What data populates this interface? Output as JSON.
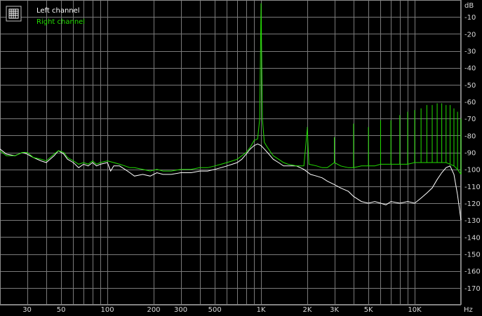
{
  "chart_data": {
    "type": "line",
    "xlabel": "Hz",
    "ylabel": "dB",
    "x_scale": "log",
    "xlim": [
      20,
      20000
    ],
    "ylim": [
      -180,
      0
    ],
    "grid": true,
    "legend_placement": "top-left",
    "x_ticks": [
      {
        "value": 30,
        "label": "30"
      },
      {
        "value": 50,
        "label": "50"
      },
      {
        "value": 100,
        "label": "100"
      },
      {
        "value": 200,
        "label": "200"
      },
      {
        "value": 300,
        "label": "300"
      },
      {
        "value": 500,
        "label": "500"
      },
      {
        "value": 1000,
        "label": "1K"
      },
      {
        "value": 2000,
        "label": "2K"
      },
      {
        "value": 3000,
        "label": "3K"
      },
      {
        "value": 5000,
        "label": "5K"
      },
      {
        "value": 10000,
        "label": "10K"
      }
    ],
    "y_ticks": [
      {
        "value": -10,
        "label": "-10"
      },
      {
        "value": -20,
        "label": "-20"
      },
      {
        "value": -30,
        "label": "-30"
      },
      {
        "value": -40,
        "label": "-40"
      },
      {
        "value": -50,
        "label": "-50"
      },
      {
        "value": -60,
        "label": "-60"
      },
      {
        "value": -70,
        "label": "-70"
      },
      {
        "value": -80,
        "label": "-80"
      },
      {
        "value": -90,
        "label": "-90"
      },
      {
        "value": -100,
        "label": "-100"
      },
      {
        "value": -110,
        "label": "-110"
      },
      {
        "value": -120,
        "label": "-120"
      },
      {
        "value": -130,
        "label": "-130"
      },
      {
        "value": -140,
        "label": "-140"
      },
      {
        "value": -150,
        "label": "-150"
      },
      {
        "value": -160,
        "label": "-160"
      },
      {
        "value": -170,
        "label": "-170"
      }
    ],
    "series": [
      {
        "name": "Left channel",
        "color": "#ffffff",
        "points": [
          [
            20,
            -88
          ],
          [
            22,
            -91
          ],
          [
            25,
            -92
          ],
          [
            28,
            -90
          ],
          [
            30,
            -91
          ],
          [
            33,
            -93
          ],
          [
            37,
            -95
          ],
          [
            40,
            -96
          ],
          [
            45,
            -92
          ],
          [
            48,
            -89
          ],
          [
            52,
            -91
          ],
          [
            55,
            -94
          ],
          [
            60,
            -96
          ],
          [
            65,
            -99
          ],
          [
            70,
            -97
          ],
          [
            75,
            -98
          ],
          [
            80,
            -96
          ],
          [
            85,
            -98
          ],
          [
            90,
            -97
          ],
          [
            100,
            -96
          ],
          [
            105,
            -101
          ],
          [
            110,
            -98
          ],
          [
            120,
            -98
          ],
          [
            130,
            -100
          ],
          [
            140,
            -102
          ],
          [
            150,
            -104
          ],
          [
            170,
            -103
          ],
          [
            190,
            -104
          ],
          [
            210,
            -102
          ],
          [
            230,
            -103
          ],
          [
            260,
            -103
          ],
          [
            300,
            -102
          ],
          [
            350,
            -102
          ],
          [
            400,
            -101
          ],
          [
            450,
            -101
          ],
          [
            500,
            -100
          ],
          [
            550,
            -99
          ],
          [
            600,
            -98
          ],
          [
            650,
            -97
          ],
          [
            700,
            -96
          ],
          [
            750,
            -94
          ],
          [
            800,
            -91
          ],
          [
            850,
            -88
          ],
          [
            900,
            -86
          ],
          [
            950,
            -85
          ],
          [
            1000,
            -86
          ],
          [
            1050,
            -88
          ],
          [
            1100,
            -90
          ],
          [
            1200,
            -94
          ],
          [
            1300,
            -96
          ],
          [
            1400,
            -98
          ],
          [
            1500,
            -98
          ],
          [
            1700,
            -98
          ],
          [
            1900,
            -100
          ],
          [
            2100,
            -103
          ],
          [
            2300,
            -104
          ],
          [
            2500,
            -105
          ],
          [
            2700,
            -107
          ],
          [
            3000,
            -109
          ],
          [
            3300,
            -111
          ],
          [
            3700,
            -113
          ],
          [
            4000,
            -116
          ],
          [
            4500,
            -119
          ],
          [
            5000,
            -120
          ],
          [
            5500,
            -119
          ],
          [
            6000,
            -120
          ],
          [
            6500,
            -121
          ],
          [
            7000,
            -119
          ],
          [
            8000,
            -120
          ],
          [
            9000,
            -119
          ],
          [
            10000,
            -120
          ],
          [
            11000,
            -117
          ],
          [
            12000,
            -114
          ],
          [
            13000,
            -111
          ],
          [
            14000,
            -106
          ],
          [
            15000,
            -102
          ],
          [
            16000,
            -99
          ],
          [
            17000,
            -98
          ],
          [
            18000,
            -103
          ],
          [
            19000,
            -115
          ],
          [
            20000,
            -130
          ]
        ]
      },
      {
        "name": "Right channel",
        "color": "#22dd00",
        "points": [
          [
            20,
            -89
          ],
          [
            22,
            -92
          ],
          [
            25,
            -92
          ],
          [
            28,
            -90
          ],
          [
            30,
            -90
          ],
          [
            33,
            -93
          ],
          [
            37,
            -94
          ],
          [
            40,
            -95
          ],
          [
            45,
            -91
          ],
          [
            48,
            -89
          ],
          [
            52,
            -90
          ],
          [
            55,
            -93
          ],
          [
            60,
            -95
          ],
          [
            65,
            -97
          ],
          [
            70,
            -96
          ],
          [
            75,
            -97
          ],
          [
            80,
            -95
          ],
          [
            85,
            -97
          ],
          [
            90,
            -96
          ],
          [
            100,
            -95
          ],
          [
            110,
            -96
          ],
          [
            120,
            -97
          ],
          [
            130,
            -98
          ],
          [
            140,
            -99
          ],
          [
            150,
            -99
          ],
          [
            170,
            -100
          ],
          [
            190,
            -101
          ],
          [
            210,
            -100
          ],
          [
            230,
            -101
          ],
          [
            260,
            -101
          ],
          [
            300,
            -100
          ],
          [
            350,
            -100
          ],
          [
            400,
            -99
          ],
          [
            450,
            -99
          ],
          [
            500,
            -98
          ],
          [
            550,
            -97
          ],
          [
            600,
            -96
          ],
          [
            650,
            -95
          ],
          [
            700,
            -94
          ],
          [
            750,
            -92
          ],
          [
            800,
            -90
          ],
          [
            850,
            -87
          ],
          [
            900,
            -83
          ],
          [
            950,
            -82
          ],
          [
            980,
            -70
          ],
          [
            1000,
            -2
          ],
          [
            1020,
            -70
          ],
          [
            1050,
            -84
          ],
          [
            1100,
            -87
          ],
          [
            1200,
            -92
          ],
          [
            1300,
            -94
          ],
          [
            1400,
            -96
          ],
          [
            1500,
            -97
          ],
          [
            1700,
            -98
          ],
          [
            1900,
            -98
          ],
          [
            2000,
            -76
          ],
          [
            2050,
            -97
          ],
          [
            2300,
            -98
          ],
          [
            2500,
            -99
          ],
          [
            2700,
            -99
          ],
          [
            3000,
            -96
          ],
          [
            3300,
            -98
          ],
          [
            3700,
            -99
          ],
          [
            4000,
            -99
          ],
          [
            4500,
            -98
          ],
          [
            5000,
            -98
          ],
          [
            5500,
            -98
          ],
          [
            6000,
            -97
          ],
          [
            6500,
            -97
          ],
          [
            7000,
            -97
          ],
          [
            8000,
            -97
          ],
          [
            9000,
            -97
          ],
          [
            10000,
            -96
          ],
          [
            11000,
            -96
          ],
          [
            12000,
            -96
          ],
          [
            13000,
            -96
          ],
          [
            14000,
            -96
          ],
          [
            15000,
            -96
          ],
          [
            16000,
            -96
          ],
          [
            17000,
            -97
          ],
          [
            18000,
            -98
          ],
          [
            19000,
            -100
          ],
          [
            20000,
            -103
          ]
        ]
      }
    ],
    "harmonic_spikes": [
      {
        "series": "Right channel",
        "x": 2000,
        "y": -75
      },
      {
        "series": "Right channel",
        "x": 3000,
        "y": -81
      },
      {
        "series": "Right channel",
        "x": 4000,
        "y": -73
      },
      {
        "series": "Right channel",
        "x": 5000,
        "y": -75
      },
      {
        "series": "Right channel",
        "x": 6000,
        "y": -71
      },
      {
        "series": "Right channel",
        "x": 7000,
        "y": -71
      },
      {
        "series": "Right channel",
        "x": 8000,
        "y": -68
      },
      {
        "series": "Right channel",
        "x": 9000,
        "y": -66
      },
      {
        "series": "Right channel",
        "x": 10000,
        "y": -65
      },
      {
        "series": "Right channel",
        "x": 11000,
        "y": -64
      },
      {
        "series": "Right channel",
        "x": 12000,
        "y": -62
      },
      {
        "series": "Right channel",
        "x": 13000,
        "y": -62
      },
      {
        "series": "Right channel",
        "x": 14000,
        "y": -61
      },
      {
        "series": "Right channel",
        "x": 15000,
        "y": -61
      },
      {
        "series": "Right channel",
        "x": 16000,
        "y": -62
      },
      {
        "series": "Right channel",
        "x": 17000,
        "y": -62
      },
      {
        "series": "Right channel",
        "x": 18000,
        "y": -64
      },
      {
        "series": "Right channel",
        "x": 19000,
        "y": -66
      },
      {
        "series": "Right channel",
        "x": 20000,
        "y": -70
      }
    ],
    "legend": [
      {
        "label": "Left channel",
        "color": "#ffffff"
      },
      {
        "label": "Right channel",
        "color": "#22dd00"
      }
    ]
  }
}
